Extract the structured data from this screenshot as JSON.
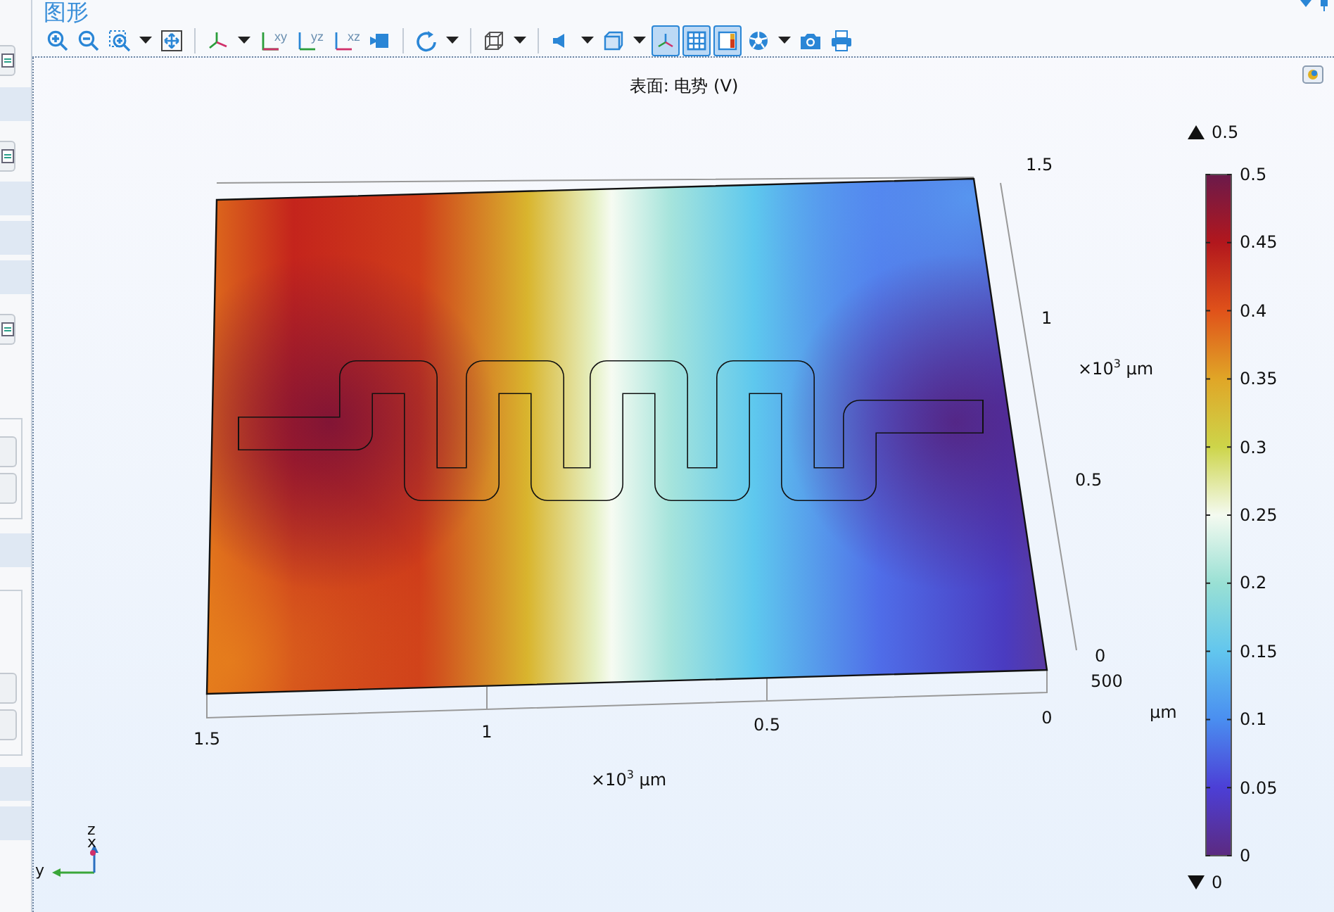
{
  "panel": {
    "title": "图形"
  },
  "toolbar": [
    {
      "kind": "button",
      "dropdown": false
    },
    {
      "kind": "button",
      "dropdown": false
    },
    {
      "kind": "button",
      "dropdown": true
    },
    {
      "kind": "button",
      "dropdown": false
    },
    {
      "kind": "separator"
    },
    {
      "kind": "button",
      "dropdown": true
    },
    {
      "kind": "button",
      "dropdown": false,
      "label": "xy"
    },
    {
      "kind": "button",
      "dropdown": false,
      "label": "yz"
    },
    {
      "kind": "button",
      "dropdown": false,
      "label": "xz"
    },
    {
      "kind": "button",
      "dropdown": false
    },
    {
      "kind": "separator"
    },
    {
      "kind": "button",
      "dropdown": true
    },
    {
      "kind": "separator"
    },
    {
      "kind": "button",
      "dropdown": true
    },
    {
      "kind": "separator"
    },
    {
      "kind": "button",
      "dropdown": true
    },
    {
      "kind": "button",
      "dropdown": true
    },
    {
      "kind": "toggle",
      "selected": true
    },
    {
      "kind": "toggle",
      "selected": true
    },
    {
      "kind": "toggle",
      "selected": true
    },
    {
      "kind": "button",
      "dropdown": true
    },
    {
      "kind": "button",
      "dropdown": false
    },
    {
      "kind": "button",
      "dropdown": false
    }
  ],
  "plot": {
    "title": "表面: 电势 (V)",
    "x_axis": {
      "ticks": [
        "1.5",
        "1",
        "0.5",
        "0"
      ],
      "unit": "×10$^{3}$ μm"
    },
    "y_axis": {
      "ticks": [
        "1.5",
        "1",
        "0.5",
        "0"
      ],
      "unit": "×10$^{3}$ μm"
    },
    "z_axis": {
      "ticks": [
        "500"
      ],
      "unit": "μm"
    },
    "colorbar": {
      "max_label": "0.5",
      "min_label": "0",
      "ticks": [
        "0.5",
        "0.45",
        "0.4",
        "0.35",
        "0.3",
        "0.25",
        "0.2",
        "0.15",
        "0.1",
        "0.05",
        "0"
      ]
    },
    "triad": {
      "labels": [
        "z",
        "x",
        "y"
      ]
    }
  }
}
